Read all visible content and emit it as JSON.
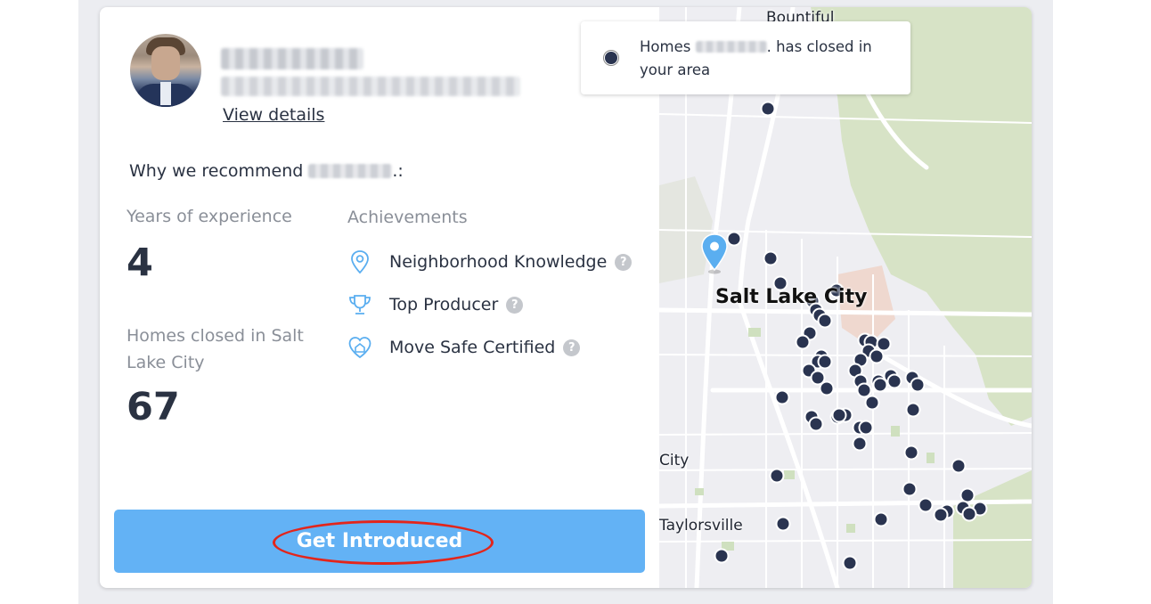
{
  "agent": {
    "view_details_label": "View details"
  },
  "recommendation": {
    "why_prefix": "Why we recommend ",
    "why_suffix": ".:"
  },
  "stats": {
    "years_label": "Years of experience",
    "years_value": "4",
    "homes_label": "Homes closed in Salt Lake City",
    "homes_value": "67"
  },
  "achievements": {
    "title": "Achievements",
    "items": [
      {
        "label": "Neighborhood Knowledge",
        "icon": "map-pin-icon"
      },
      {
        "label": "Top Producer",
        "icon": "trophy-icon"
      },
      {
        "label": "Move Safe Certified",
        "icon": "heart-house-icon"
      }
    ],
    "help_glyph": "?"
  },
  "cta": {
    "label": "Get Introduced"
  },
  "map": {
    "labels": {
      "bountiful": "Bountiful",
      "salt_lake_city": "Salt Lake City",
      "city_fragment": "City",
      "taylorsville": "Taylorsville"
    },
    "legend": {
      "prefix": "Homes ",
      "suffix": ". has closed in your area"
    },
    "colors": {
      "dot": "#2a3450",
      "pin": "#5aaef0",
      "park": "#d7e3c6"
    }
  },
  "colors": {
    "cta": "#63b2f5",
    "accent_icon": "#5aaef0",
    "annotation_ring": "#e3251b"
  }
}
